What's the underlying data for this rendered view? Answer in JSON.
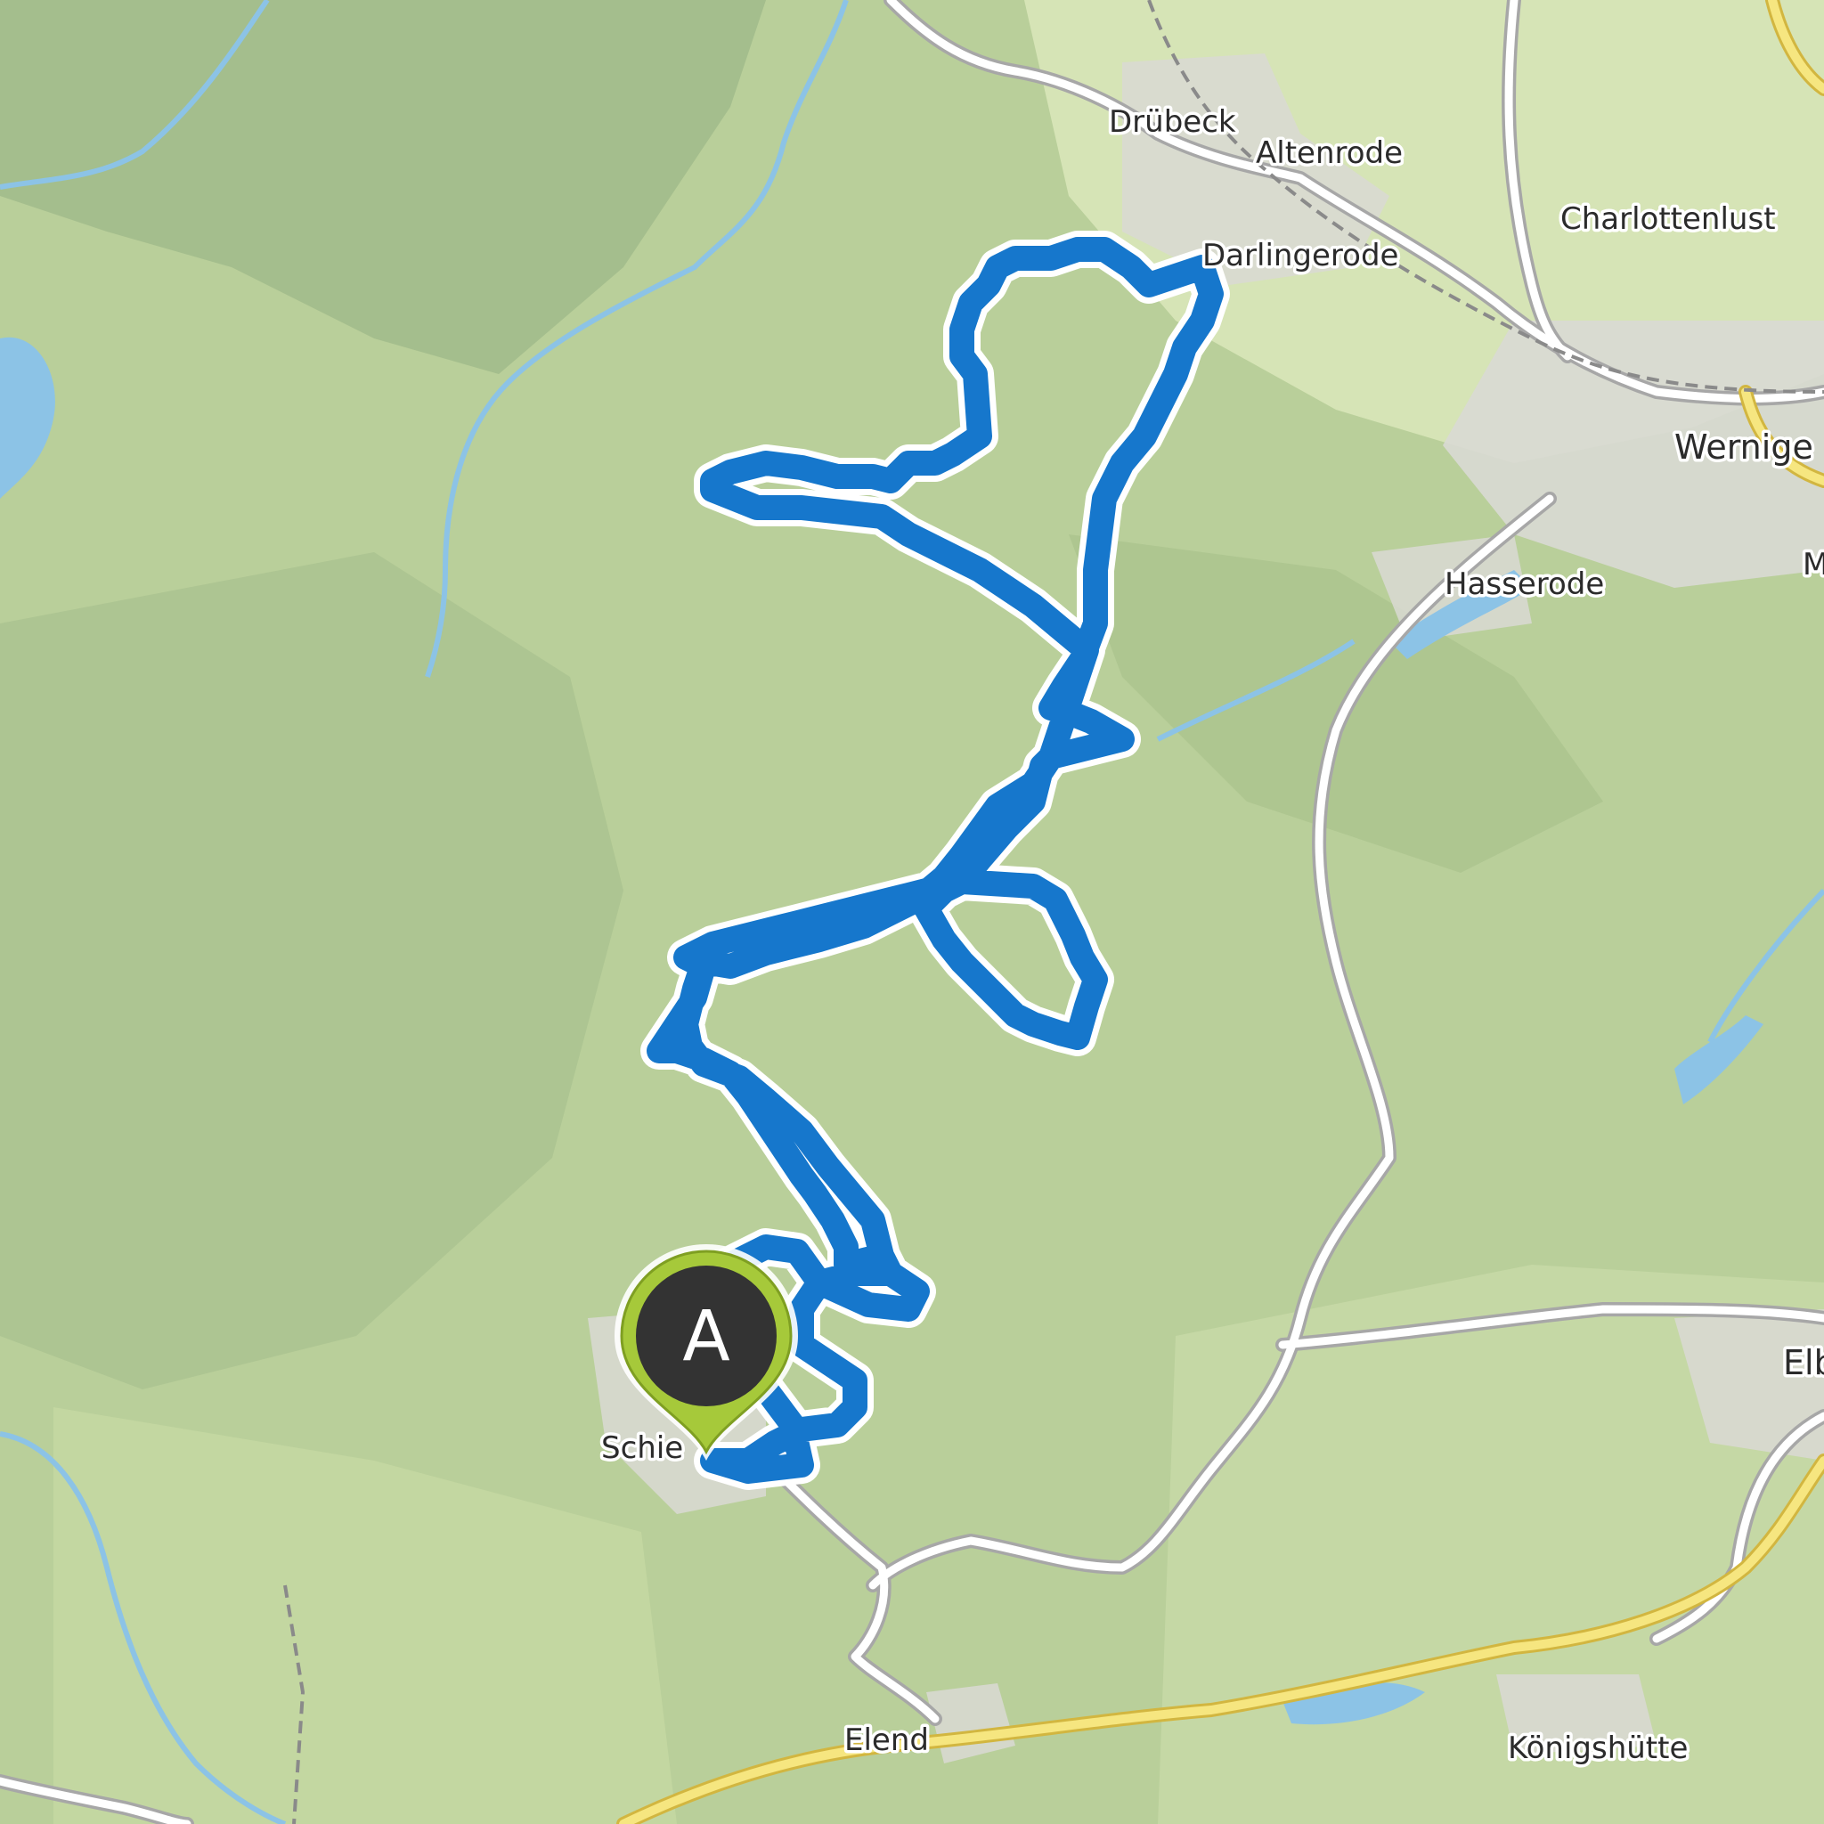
{
  "map": {
    "colors": {
      "terrain": "#b9cf9a",
      "forest_dark": "#9fb989",
      "valley_light": "#d6e4b6",
      "town": "#d9d9d4",
      "water": "#8cc3e6",
      "road": "#ffffff",
      "road_casing": "#a7a7a7",
      "main_road": "#f6e680",
      "main_road_casing": "#d2b640",
      "route": "#1677cc",
      "route_outline": "#ffffff"
    },
    "places": [
      {
        "id": "druebeck",
        "name": "Drübeck"
      },
      {
        "id": "altenrode",
        "name": "Altenrode"
      },
      {
        "id": "charlottenlust",
        "name": "Charlottenlust"
      },
      {
        "id": "darlingerode",
        "name": "Darlingerode"
      },
      {
        "id": "wernigerode",
        "name": "Wernige"
      },
      {
        "id": "hasserode",
        "name": "Hasserode"
      },
      {
        "id": "elbingerode",
        "name": "Elbin"
      },
      {
        "id": "schierke",
        "name": "Schie"
      },
      {
        "id": "elend",
        "name": "Elend"
      },
      {
        "id": "koenigshuette",
        "name": "Königshütte"
      },
      {
        "id": "edge_m",
        "name": "M"
      }
    ],
    "route": {
      "color": "#1677cc"
    },
    "start_marker": {
      "letter": "A",
      "pin_color": "#a6c93a",
      "disc_color": "#333333"
    }
  }
}
